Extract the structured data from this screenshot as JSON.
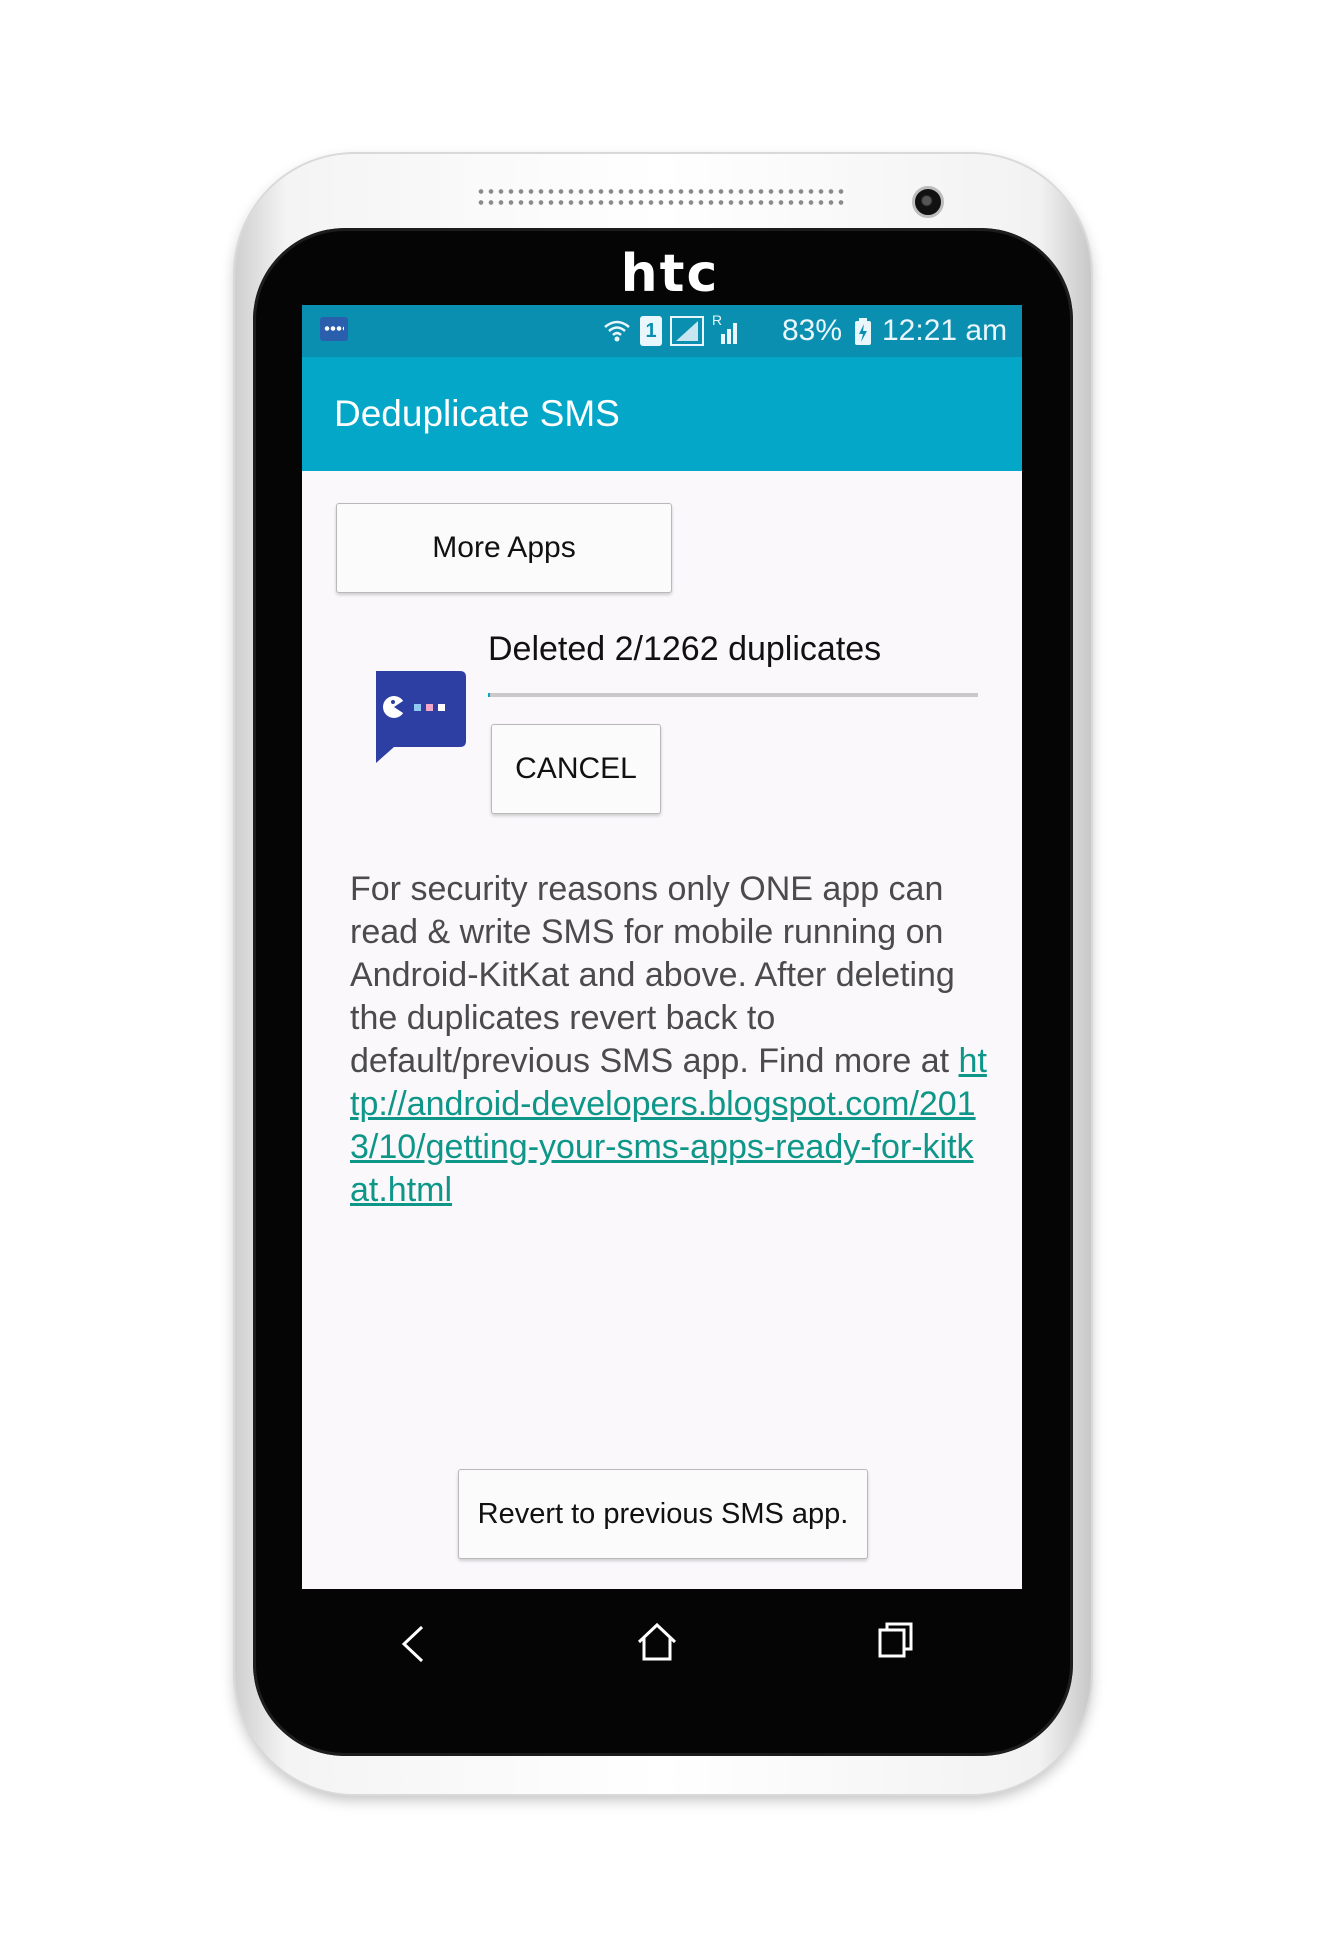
{
  "device": {
    "brand": "htc"
  },
  "status_bar": {
    "battery_percent": "83%",
    "time": "12:21 am",
    "sim_label": "1",
    "roaming_label": "R"
  },
  "app_bar": {
    "title": "Deduplicate SMS"
  },
  "main": {
    "more_apps_label": "More Apps",
    "progress_text": "Deleted 2/1262 duplicates",
    "progress": {
      "done": 2,
      "total": 1262
    },
    "cancel_label": "CANCEL",
    "info_text": "For security reasons only ONE app can read & write SMS for mobile running on Android-KitKat and above. After deleting the duplicates revert back to default/previous SMS app. Find more at ",
    "info_link": "http://android-developers.blogspot.com/2013/10/getting-your-sms-apps-ready-for-kitkat.html",
    "revert_label": "Revert to previous SMS app."
  },
  "icons": {
    "status_app": "sms-notification-icon",
    "wifi": "wifi-icon",
    "sim": "sim-1-icon",
    "signal": "signal-icon",
    "signal_roaming": "signal-roaming-icon",
    "battery": "battery-charging-icon",
    "app": "dedupe-sms-app-icon",
    "nav_back": "back-icon",
    "nav_home": "home-icon",
    "nav_recents": "recents-icon"
  },
  "colors": {
    "status_bar": "#0a8fb0",
    "app_bar": "#05a7c9",
    "link": "#0e9688",
    "app_icon": "#2e3fa3"
  }
}
